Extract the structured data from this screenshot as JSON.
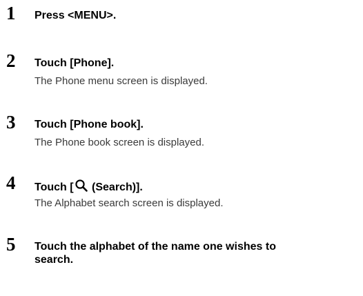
{
  "steps": [
    {
      "number": "1",
      "title": "Press <MENU>."
    },
    {
      "number": "2",
      "title": "Touch [Phone].",
      "description": "The Phone menu screen is displayed."
    },
    {
      "number": "3",
      "title": "Touch [Phone book].",
      "description": "The Phone book screen is displayed."
    },
    {
      "number": "4",
      "title_prefix": "Touch [",
      "title_icon": "search-icon",
      "title_suffix": " (Search)].",
      "description": "The Alphabet search screen is displayed."
    },
    {
      "number": "5",
      "title_line1": "Touch the alphabet of the name one wishes to",
      "title_line2": "search."
    }
  ]
}
